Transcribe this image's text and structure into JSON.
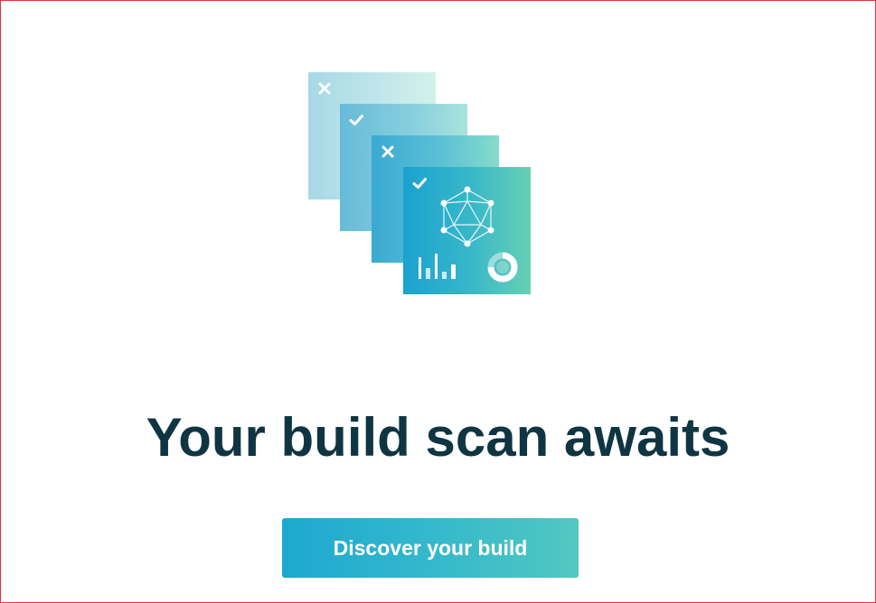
{
  "hero": {
    "cards": [
      {
        "status_icon": "close-icon"
      },
      {
        "status_icon": "check-icon"
      },
      {
        "status_icon": "close-icon"
      },
      {
        "status_icon": "check-icon",
        "graphics": [
          "network-graph-icon",
          "bar-chart-icon",
          "donut-chart-icon"
        ]
      }
    ]
  },
  "headline": "Your build scan awaits",
  "cta": {
    "label": "Discover your build"
  },
  "colors": {
    "headline": "#0f3542",
    "button_gradient_start": "#1da8d1",
    "button_gradient_end": "#52c8c0",
    "frame_border": "#e0343c"
  }
}
